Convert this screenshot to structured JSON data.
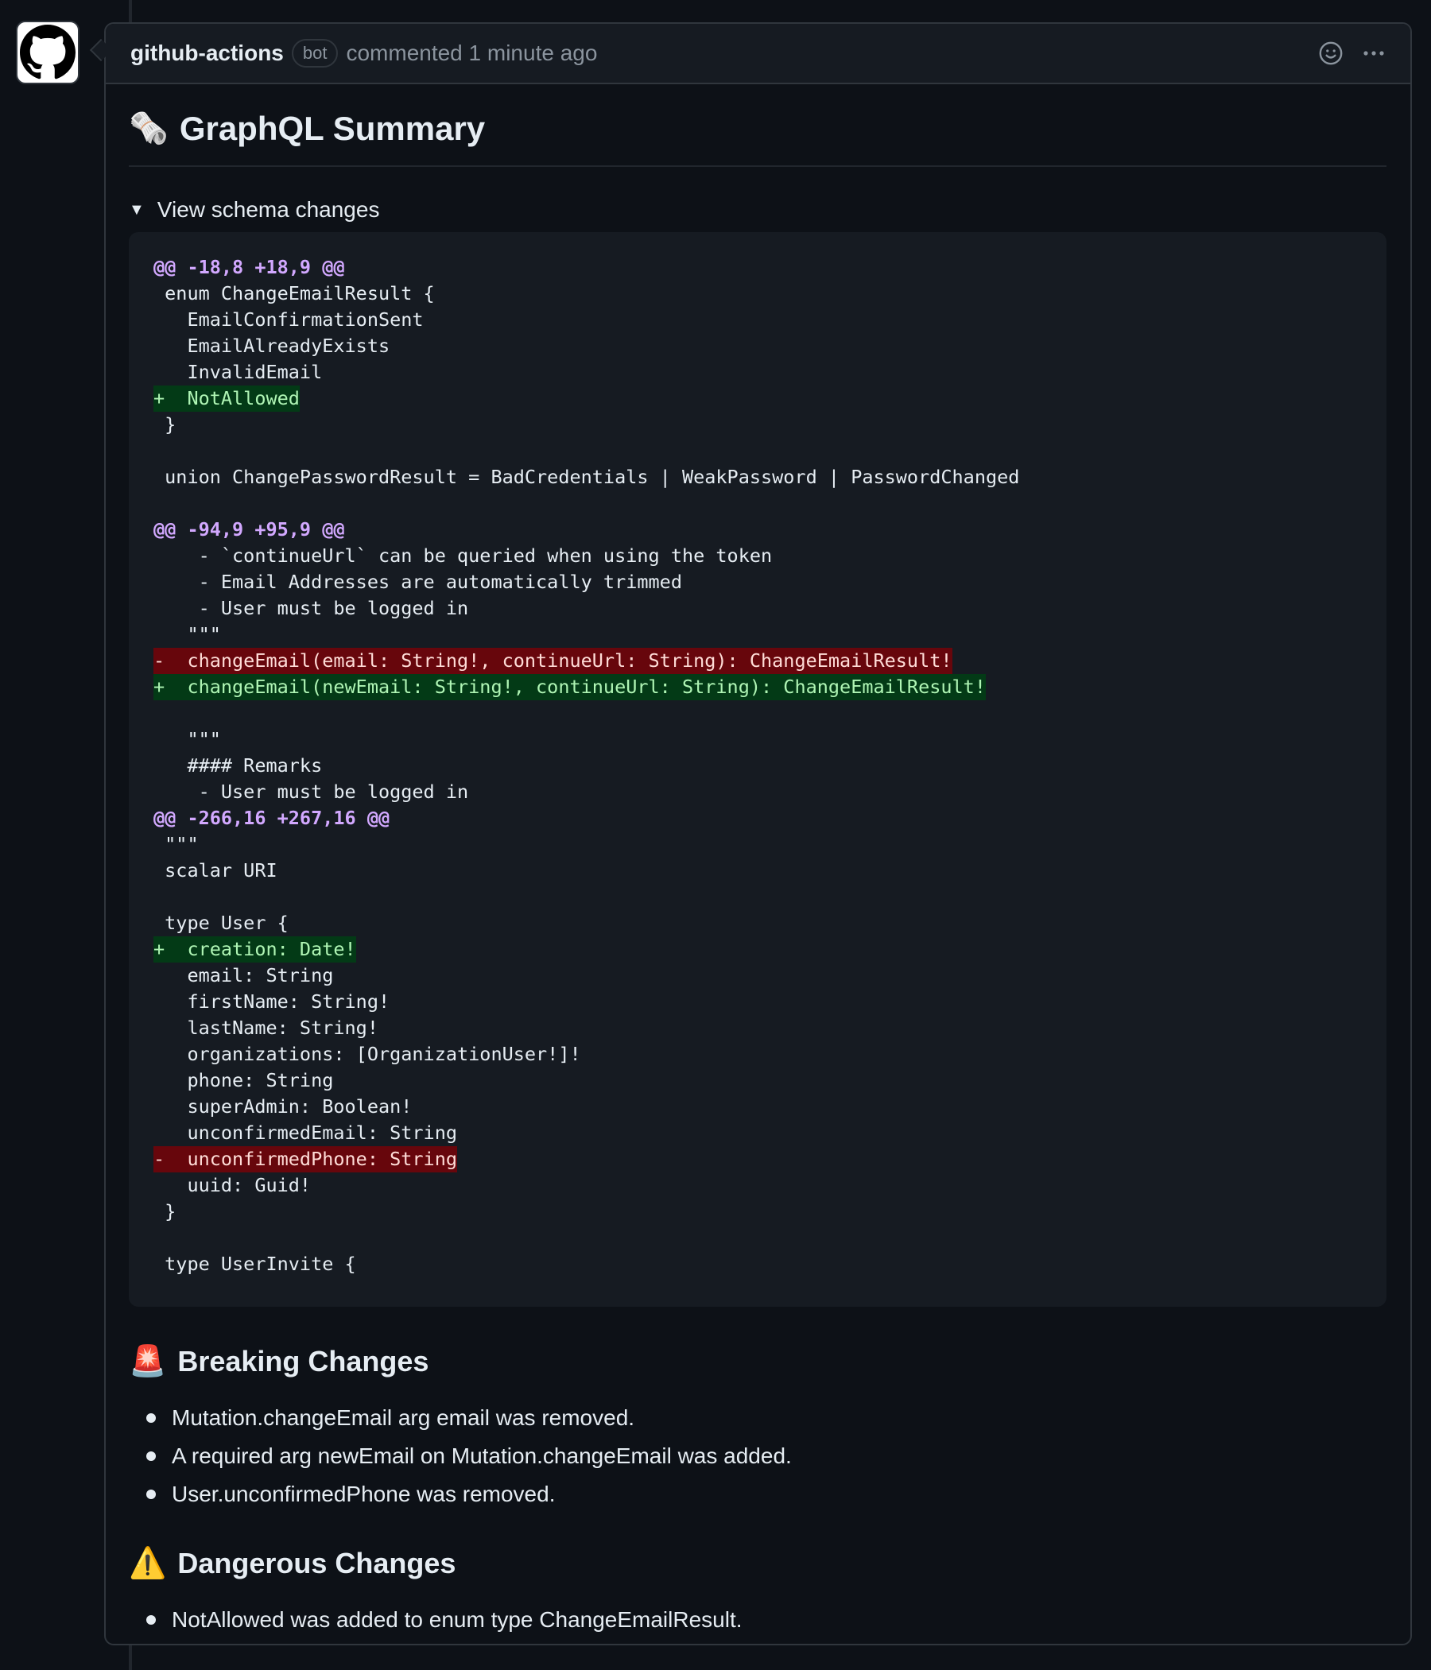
{
  "comment": {
    "author": "github-actions",
    "badge": "bot",
    "meta": "commented 1 minute ago"
  },
  "summary": {
    "emoji": "🗞️",
    "title": "GraphQL Summary"
  },
  "details": {
    "triangle": "▼",
    "summary_label": "View schema changes"
  },
  "diff_lines": [
    {
      "type": "hunk",
      "text": "@@ -18,8 +18,9 @@"
    },
    {
      "type": "ctx",
      "text": " enum ChangeEmailResult {"
    },
    {
      "type": "ctx",
      "text": "   EmailConfirmationSent"
    },
    {
      "type": "ctx",
      "text": "   EmailAlreadyExists"
    },
    {
      "type": "ctx",
      "text": "   InvalidEmail"
    },
    {
      "type": "add",
      "text": "+  NotAllowed"
    },
    {
      "type": "ctx",
      "text": " }"
    },
    {
      "type": "ctx",
      "text": " "
    },
    {
      "type": "ctx",
      "text": " union ChangePasswordResult = BadCredentials | WeakPassword | PasswordChanged"
    },
    {
      "type": "ctx",
      "text": " "
    },
    {
      "type": "hunk",
      "text": "@@ -94,9 +95,9 @@"
    },
    {
      "type": "ctx",
      "text": "    - `continueUrl` can be queried when using the token"
    },
    {
      "type": "ctx",
      "text": "    - Email Addresses are automatically trimmed"
    },
    {
      "type": "ctx",
      "text": "    - User must be logged in"
    },
    {
      "type": "ctx",
      "text": "   \"\"\""
    },
    {
      "type": "del",
      "text": "-  changeEmail(email: String!, continueUrl: String): ChangeEmailResult!"
    },
    {
      "type": "add",
      "text": "+  changeEmail(newEmail: String!, continueUrl: String): ChangeEmailResult!"
    },
    {
      "type": "ctx",
      "text": " "
    },
    {
      "type": "ctx",
      "text": "   \"\"\""
    },
    {
      "type": "ctx",
      "text": "   #### Remarks"
    },
    {
      "type": "ctx",
      "text": "    - User must be logged in"
    },
    {
      "type": "hunk",
      "text": "@@ -266,16 +267,16 @@"
    },
    {
      "type": "ctx",
      "text": " \"\"\""
    },
    {
      "type": "ctx",
      "text": " scalar URI"
    },
    {
      "type": "ctx",
      "text": " "
    },
    {
      "type": "ctx",
      "text": " type User {"
    },
    {
      "type": "add",
      "text": "+  creation: Date!"
    },
    {
      "type": "ctx",
      "text": "   email: String"
    },
    {
      "type": "ctx",
      "text": "   firstName: String!"
    },
    {
      "type": "ctx",
      "text": "   lastName: String!"
    },
    {
      "type": "ctx",
      "text": "   organizations: [OrganizationUser!]!"
    },
    {
      "type": "ctx",
      "text": "   phone: String"
    },
    {
      "type": "ctx",
      "text": "   superAdmin: Boolean!"
    },
    {
      "type": "ctx",
      "text": "   unconfirmedEmail: String"
    },
    {
      "type": "del",
      "text": "-  unconfirmedPhone: String"
    },
    {
      "type": "ctx",
      "text": "   uuid: Guid!"
    },
    {
      "type": "ctx",
      "text": " }"
    },
    {
      "type": "ctx",
      "text": " "
    },
    {
      "type": "ctx",
      "text": " type UserInvite {"
    }
  ],
  "breaking": {
    "emoji": "🚨",
    "title": "Breaking Changes",
    "items": [
      "Mutation.changeEmail arg email was removed.",
      "A required arg newEmail on Mutation.changeEmail was added.",
      "User.unconfirmedPhone was removed."
    ]
  },
  "dangerous": {
    "emoji": "⚠️",
    "title": "Dangerous Changes",
    "items": [
      "NotAllowed was added to enum type ChangeEmailResult."
    ]
  },
  "icons": {
    "avatar": "github-mark-icon",
    "reaction": "smiley-icon",
    "menu": "kebab-horizontal-icon"
  },
  "colors": {
    "background": "#0d1117",
    "header_bg": "#161b22",
    "border": "#30363d",
    "hunk": "#d2a8ff",
    "add_bg": "#033a16",
    "add_fg": "#aff5b4",
    "del_bg": "#67060c",
    "del_fg": "#ffdcd7"
  }
}
